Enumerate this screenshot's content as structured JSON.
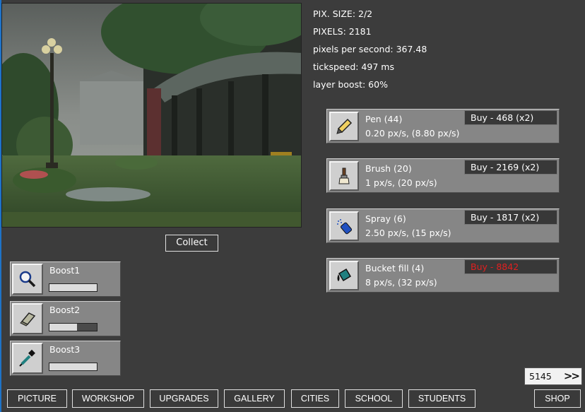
{
  "stats": {
    "pix_size": "PIX. SIZE: 2/2",
    "pixels": "PIXELS: 2181",
    "pps": "pixels per second: 367.48",
    "tickspeed": "tickspeed: 497 ms",
    "layer_boost": "layer boost: 60%"
  },
  "collect_label": "Collect",
  "tools": [
    {
      "name": "Pen (44)",
      "rate": "0.20 px/s, (8.80 px/s)",
      "buy": "Buy - 468 (x2)",
      "icon": "pen-icon",
      "affordable": true
    },
    {
      "name": "Brush (20)",
      "rate": "1 px/s, (20 px/s)",
      "buy": "Buy - 2169 (x2)",
      "icon": "brush-icon",
      "affordable": true
    },
    {
      "name": "Spray (6)",
      "rate": "2.50 px/s, (15 px/s)",
      "buy": "Buy - 1817 (x2)",
      "icon": "spray-icon",
      "affordable": true
    },
    {
      "name": "Bucket fill (4)",
      "rate": "8 px/s, (32 px/s)",
      "buy": "Buy - 8842",
      "icon": "bucket-fill-icon",
      "affordable": false
    }
  ],
  "boosts": [
    {
      "label": "Boost1",
      "icon": "magnifier-icon",
      "progress": 1.0
    },
    {
      "label": "Boost2",
      "icon": "eraser-icon",
      "progress": 0.58
    },
    {
      "label": "Boost3",
      "icon": "eyedropper-icon",
      "progress": 1.0
    }
  ],
  "counter": {
    "value": "5145",
    "arrow": ">>"
  },
  "nav": {
    "picture": "PICTURE",
    "workshop": "WORKSHOP",
    "upgrades": "UPGRADES",
    "gallery": "GALLERY",
    "cities": "CITIES",
    "school": "SCHOOL",
    "students": "STUDENTS",
    "shop": "SHOP"
  },
  "colors": {
    "background": "#3c3c3c",
    "panel": "#868686",
    "unaffordable": "#e02020"
  }
}
